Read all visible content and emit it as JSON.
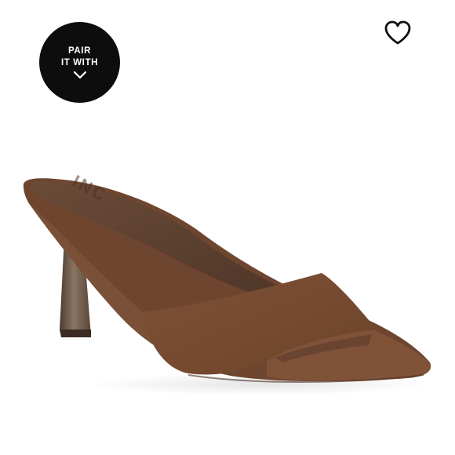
{
  "badge": {
    "line1": "PAIR",
    "line2": "IT WITH",
    "icon": "chevron-down-icon",
    "bg_color": "#0d0d0d",
    "text_color": "#ffffff"
  },
  "favorite": {
    "icon": "heart-outline-icon"
  },
  "product": {
    "image_content": "brown suede pointed-toe heeled mule sandal",
    "insole_logo": "INC",
    "color": "#7a4f37"
  }
}
